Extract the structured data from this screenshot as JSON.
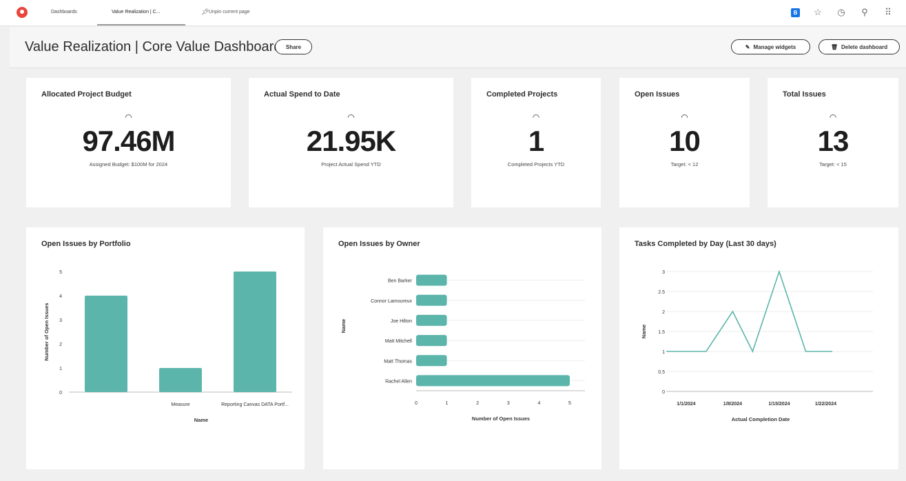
{
  "nav": {
    "tabs": [
      "Dashboards",
      "Value Realization | C..."
    ],
    "unpin_label": "Unpin current page",
    "icons": [
      "app-badge-icon",
      "star-icon",
      "history-icon",
      "search-icon",
      "grid-icon"
    ],
    "badge_letter": "B"
  },
  "header": {
    "title": "Value Realization | Core Value Dashboard",
    "share_label": "Share",
    "manage_label": "Manage widgets",
    "delete_label": "Delete dashboard"
  },
  "kpis": [
    {
      "title": "Allocated Project Budget",
      "value": "97.46M",
      "sub": "Assigned Budget: $100M for 2024"
    },
    {
      "title": "Actual Spend to Date",
      "value": "21.95K",
      "sub": "Project Actual Spend YTD"
    },
    {
      "title": "Completed Projects",
      "value": "1",
      "sub": "Completed Projects YTD"
    },
    {
      "title": "Open Issues",
      "value": "10",
      "sub": "Target: < 12"
    },
    {
      "title": "Total Issues",
      "value": "13",
      "sub": "Target: < 15"
    }
  ],
  "colors": {
    "accent": "#5bb5ab",
    "line": "#5bb5ab"
  },
  "chart_data": [
    {
      "type": "bar",
      "title": "Open Issues by Portfolio",
      "categories": [
        "",
        "Measure",
        "Reporting Canvas DATA Portf..."
      ],
      "values": [
        4,
        1,
        5
      ],
      "xlabel": "Name",
      "ylabel": "Number of Open Issues",
      "ylim": [
        0,
        5
      ],
      "yticks": [
        "0",
        "1",
        "2",
        "3",
        "4",
        "5"
      ]
    },
    {
      "type": "bar",
      "orientation": "horizontal",
      "title": "Open Issues by Owner",
      "categories": [
        "Ben Barker",
        "Connor Lamoureux",
        "Joe Hilton",
        "Matt Mitchell",
        "Matt Thomas",
        "Rachel Allen"
      ],
      "values": [
        1,
        1,
        1,
        1,
        1,
        5
      ],
      "xlabel": "Number of Open Issues",
      "ylabel": "Name",
      "xlim": [
        0,
        5
      ],
      "xticks": [
        "0",
        "1",
        "2",
        "3",
        "4",
        "5"
      ]
    },
    {
      "type": "line",
      "title": "Tasks Completed by Day (Last 30 days)",
      "x": [
        "2023-12-29",
        "2024-01-01",
        "2024-01-04",
        "2024-01-08",
        "2024-01-11",
        "2024-01-15",
        "2024-01-19",
        "2024-01-23"
      ],
      "values": [
        1,
        1,
        1,
        2,
        1,
        3,
        1,
        1
      ],
      "xticks": [
        "1/1/2024",
        "1/8/2024",
        "1/15/2024",
        "1/22/2024"
      ],
      "xlabel": "Actual Completion Date",
      "ylabel": "Name",
      "ylim": [
        0,
        3
      ],
      "yticks": [
        "0",
        "0.5",
        "1",
        "1.5",
        "2",
        "2.5",
        "3"
      ]
    }
  ]
}
